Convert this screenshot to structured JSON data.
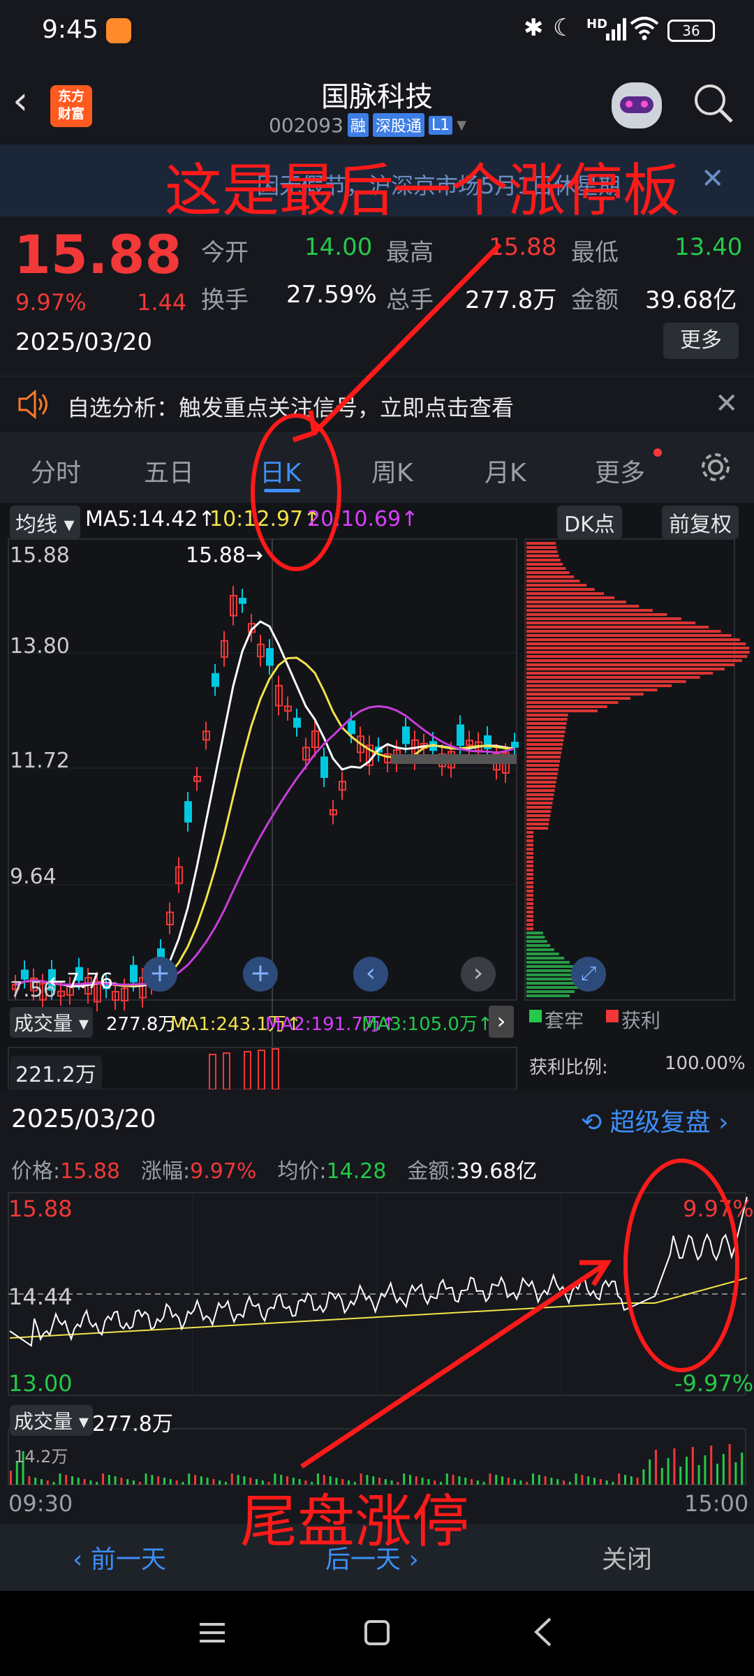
{
  "status": {
    "time": "9:45",
    "battery": "36",
    "network": "HD"
  },
  "header": {
    "logo_text": "东方\n财富",
    "stock_name": "国脉科技",
    "stock_code": "002093",
    "tags": [
      "融",
      "深股通",
      "L1"
    ]
  },
  "banner": {
    "text": "因无假节，沪深京市场5月1日休星期"
  },
  "quote": {
    "price": "15.88",
    "change_pct": "9.97%",
    "change": "1.44",
    "date": "2025/03/20",
    "stats": [
      {
        "label": "今开",
        "value": "14.00"
      },
      {
        "label": "最高",
        "value": "15.88"
      },
      {
        "label": "最低",
        "value": "13.40"
      },
      {
        "label": "换手",
        "value": "27.59%"
      },
      {
        "label": "总手",
        "value": "277.8万"
      },
      {
        "label": "金额",
        "value": "39.68亿"
      }
    ],
    "more_button": "更多"
  },
  "alert": {
    "text": "自选分析：触发重点关注信号，立即点击查看"
  },
  "tabs": [
    "分时",
    "五日",
    "日K",
    "周K",
    "月K",
    "更多"
  ],
  "kline": {
    "indicator_label": "均线",
    "ma5": "MA5:14.42↑",
    "ma10": "10:12.97↑",
    "ma20": "20:10.69↑",
    "dk_button": "DK点",
    "adj_button": "前复权",
    "y_labels": [
      "15.88",
      "13.80",
      "11.72",
      "9.64",
      "7.56"
    ],
    "high_label": "15.88",
    "low_label": "7.76",
    "volume_label": "成交量",
    "vol_value": "277.8万↑",
    "vol_ma1": "MA1:243.1万↑",
    "vol_ma2": "MA2:191.7万↑",
    "vol_ma3": "MA3:105.0万↑",
    "vol_scale": "221.2万",
    "legend_trapped": "套牢",
    "legend_profit": "获利",
    "profit_ratio_label": "获利比例:",
    "profit_ratio_value": "100.00%"
  },
  "intraday": {
    "date": "2025/03/20",
    "replay_button": "超级复盘",
    "price_label": "价格:",
    "price_value": "15.88",
    "change_label": "涨幅:",
    "change_value": "9.97%",
    "avg_label": "均价:",
    "avg_value": "14.28",
    "amount_label": "金额:",
    "amount_value": "39.68亿",
    "y_top": "15.88",
    "y_mid": "14.44",
    "y_bot": "13.00",
    "pct_top": "9.97%",
    "pct_bot": "-9.97%",
    "volume_label": "成交量",
    "volume_value": "277.8万",
    "vol_scale": "14.2万",
    "time_start": "09:30",
    "time_end": "15:00"
  },
  "bottom_nav": {
    "prev": "前一天",
    "next": "后一天",
    "close": "关闭"
  },
  "annotations": {
    "top": "这是最后一个涨停板",
    "bottom": "尾盘涨停"
  },
  "colors": {
    "up": "#f23838",
    "down": "#00c8e0",
    "ma5": "#ffffff",
    "ma10": "#f3e24c",
    "ma20": "#c83ddc",
    "annotation": "#ff1a1a"
  }
}
